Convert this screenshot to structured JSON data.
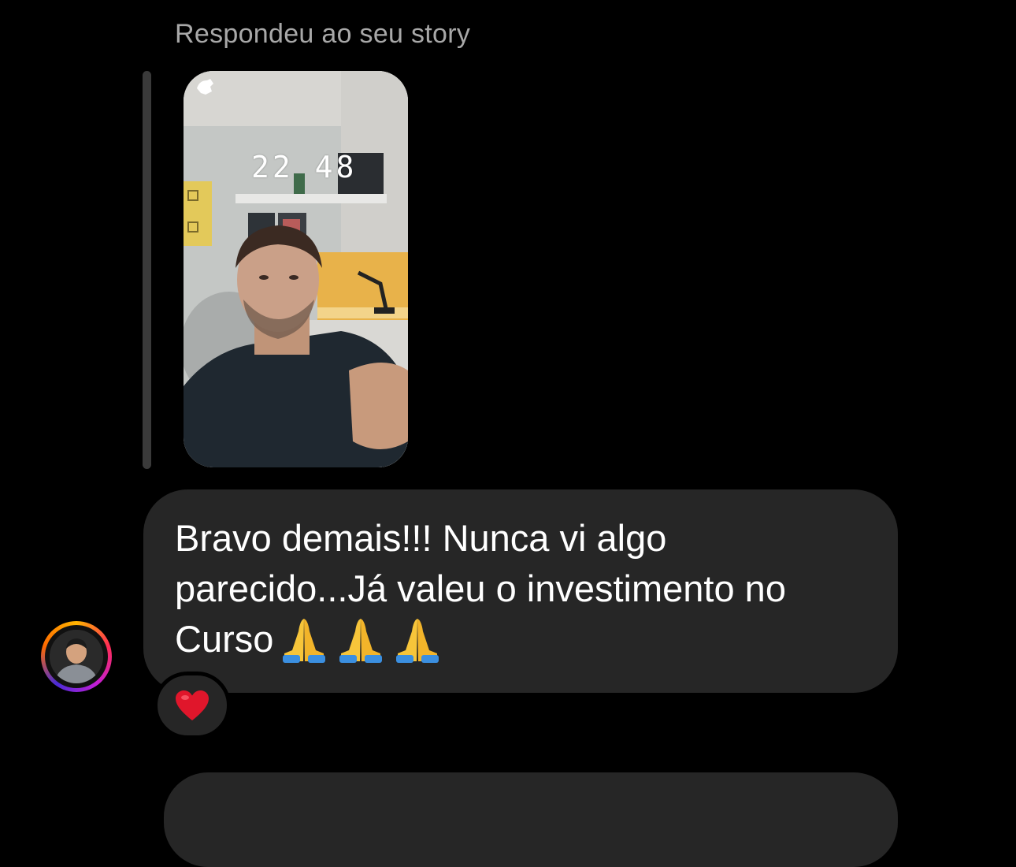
{
  "reply": {
    "label": "Respondeu ao seu story"
  },
  "story": {
    "clock_text": "22 48",
    "thumbnail_icon": "story-photo-thumbnail"
  },
  "message": {
    "text": "Bravo demais!!! Nunca vi algo\nparecido...Já valeu o investimento no\nCurso",
    "emoji_icons": [
      "folded-hands-icon",
      "folded-hands-icon",
      "folded-hands-icon"
    ]
  },
  "reaction": {
    "emoji": "❤️"
  },
  "colors": {
    "background": "#000000",
    "bubble": "#262626",
    "muted_text": "#a8a8a8",
    "heart": "#e0162b",
    "emoji_yellow": "#f7c53a",
    "emoji_blue": "#3b8fe0"
  }
}
